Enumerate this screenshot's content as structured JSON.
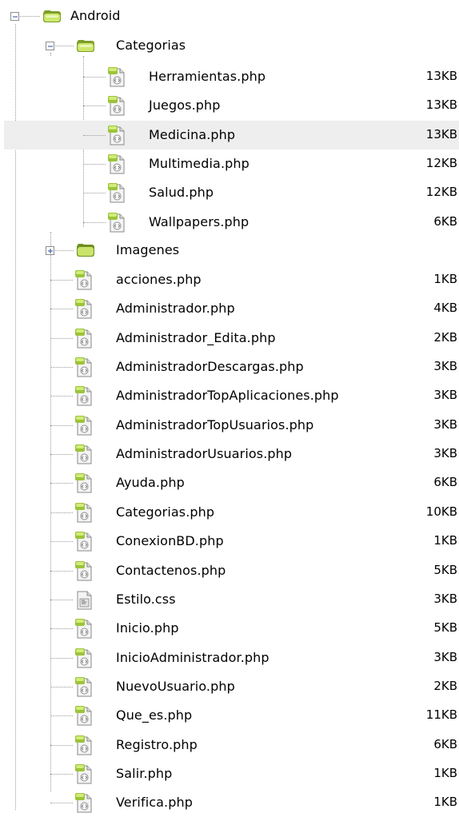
{
  "tree": {
    "root": {
      "label": "Android",
      "expanded": true,
      "icon": "folder-open-icon"
    },
    "categorias": {
      "label": "Categorias",
      "expanded": true,
      "icon": "folder-open-icon",
      "files": [
        {
          "name": "Herramientas.php",
          "size": "13KB",
          "icon": "php-file-icon"
        },
        {
          "name": "Juegos.php",
          "size": "13KB",
          "icon": "php-file-icon"
        },
        {
          "name": "Medicina.php",
          "size": "13KB",
          "icon": "php-file-icon",
          "selected": true
        },
        {
          "name": "Multimedia.php",
          "size": "12KB",
          "icon": "php-file-icon"
        },
        {
          "name": "Salud.php",
          "size": "12KB",
          "icon": "php-file-icon"
        },
        {
          "name": "Wallpapers.php",
          "size": "6KB",
          "icon": "php-file-icon"
        }
      ]
    },
    "imagenes": {
      "label": "Imagenes",
      "expanded": false,
      "icon": "folder-closed-icon"
    },
    "files": [
      {
        "name": "acciones.php",
        "size": "1KB",
        "icon": "php-file-icon"
      },
      {
        "name": "Administrador.php",
        "size": "4KB",
        "icon": "php-file-icon"
      },
      {
        "name": "Administrador_Edita.php",
        "size": "2KB",
        "icon": "php-file-icon"
      },
      {
        "name": "AdministradorDescargas.php",
        "size": "3KB",
        "icon": "php-file-icon"
      },
      {
        "name": "AdministradorTopAplicaciones.php",
        "size": "3KB",
        "icon": "php-file-icon"
      },
      {
        "name": "AdministradorTopUsuarios.php",
        "size": "3KB",
        "icon": "php-file-icon"
      },
      {
        "name": "AdministradorUsuarios.php",
        "size": "3KB",
        "icon": "php-file-icon"
      },
      {
        "name": "Ayuda.php",
        "size": "6KB",
        "icon": "php-file-icon"
      },
      {
        "name": "Categorias.php",
        "size": "10KB",
        "icon": "php-file-icon"
      },
      {
        "name": "ConexionBD.php",
        "size": "1KB",
        "icon": "php-file-icon"
      },
      {
        "name": "Contactenos.php",
        "size": "5KB",
        "icon": "php-file-icon"
      },
      {
        "name": "Estilo.css",
        "size": "3KB",
        "icon": "css-file-icon"
      },
      {
        "name": "Inicio.php",
        "size": "5KB",
        "icon": "php-file-icon"
      },
      {
        "name": "InicioAdministrador.php",
        "size": "3KB",
        "icon": "php-file-icon"
      },
      {
        "name": "NuevoUsuario.php",
        "size": "2KB",
        "icon": "php-file-icon"
      },
      {
        "name": "Que_es.php",
        "size": "11KB",
        "icon": "php-file-icon"
      },
      {
        "name": "Registro.php",
        "size": "6KB",
        "icon": "php-file-icon"
      },
      {
        "name": "Salir.php",
        "size": "1KB",
        "icon": "php-file-icon"
      },
      {
        "name": "Verifica.php",
        "size": "1KB",
        "icon": "php-file-icon"
      }
    ]
  },
  "colors": {
    "folder": "#c9e46a",
    "folder_dark": "#6e8f1f",
    "selection": "#eeeeee",
    "tree_line": "#9a9a9a"
  }
}
